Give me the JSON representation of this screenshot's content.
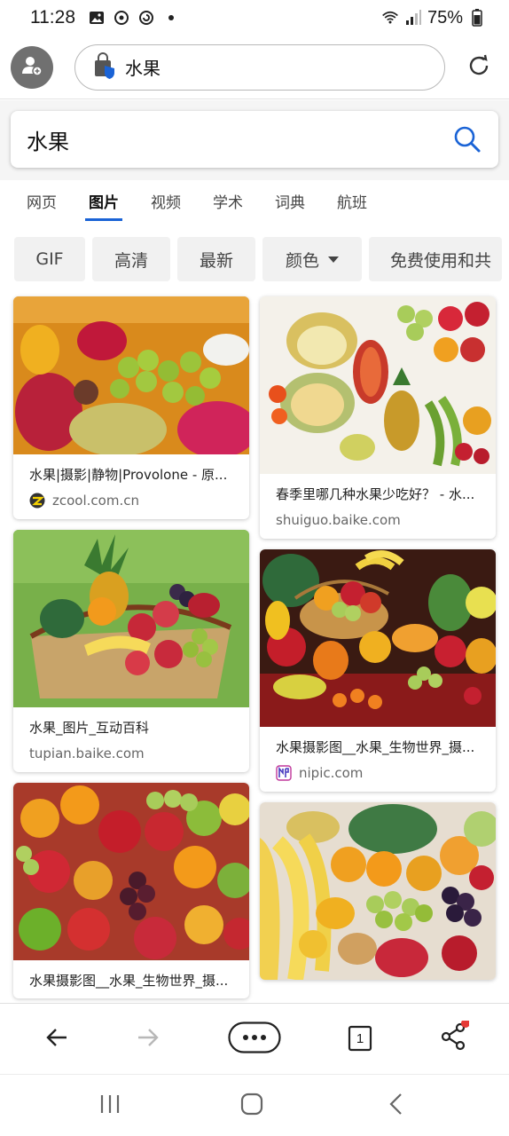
{
  "status_bar": {
    "time": "11:28",
    "battery": "75%"
  },
  "browser": {
    "url_text": "水果"
  },
  "search": {
    "query": "水果"
  },
  "tabs": [
    {
      "label": "网页",
      "active": false
    },
    {
      "label": "图片",
      "active": true
    },
    {
      "label": "视频",
      "active": false
    },
    {
      "label": "学术",
      "active": false
    },
    {
      "label": "词典",
      "active": false
    },
    {
      "label": "航班",
      "active": false
    }
  ],
  "filters": {
    "gif": "GIF",
    "hd": "高清",
    "newest": "最新",
    "color": "颜色",
    "free": "免费使用和共"
  },
  "results": {
    "left": [
      {
        "caption": "水果|摄影|静物|Provolone - 原...",
        "source": "zcool.com.cn"
      },
      {
        "caption": "水果_图片_互动百科",
        "source": "tupian.baike.com"
      },
      {
        "caption": "水果摄影图__水果_生物世界_摄..."
      }
    ],
    "right": [
      {
        "caption": "春季里哪几种水果少吃好？ - 水...",
        "source": "shuiguo.baike.com"
      },
      {
        "caption": "水果摄影图__水果_生物世界_摄...",
        "source": "nipic.com"
      }
    ]
  },
  "toolbar": {
    "tab_count": "1"
  },
  "colors": {
    "accent": "#1a63d6",
    "notification_dot": "#e53935"
  }
}
